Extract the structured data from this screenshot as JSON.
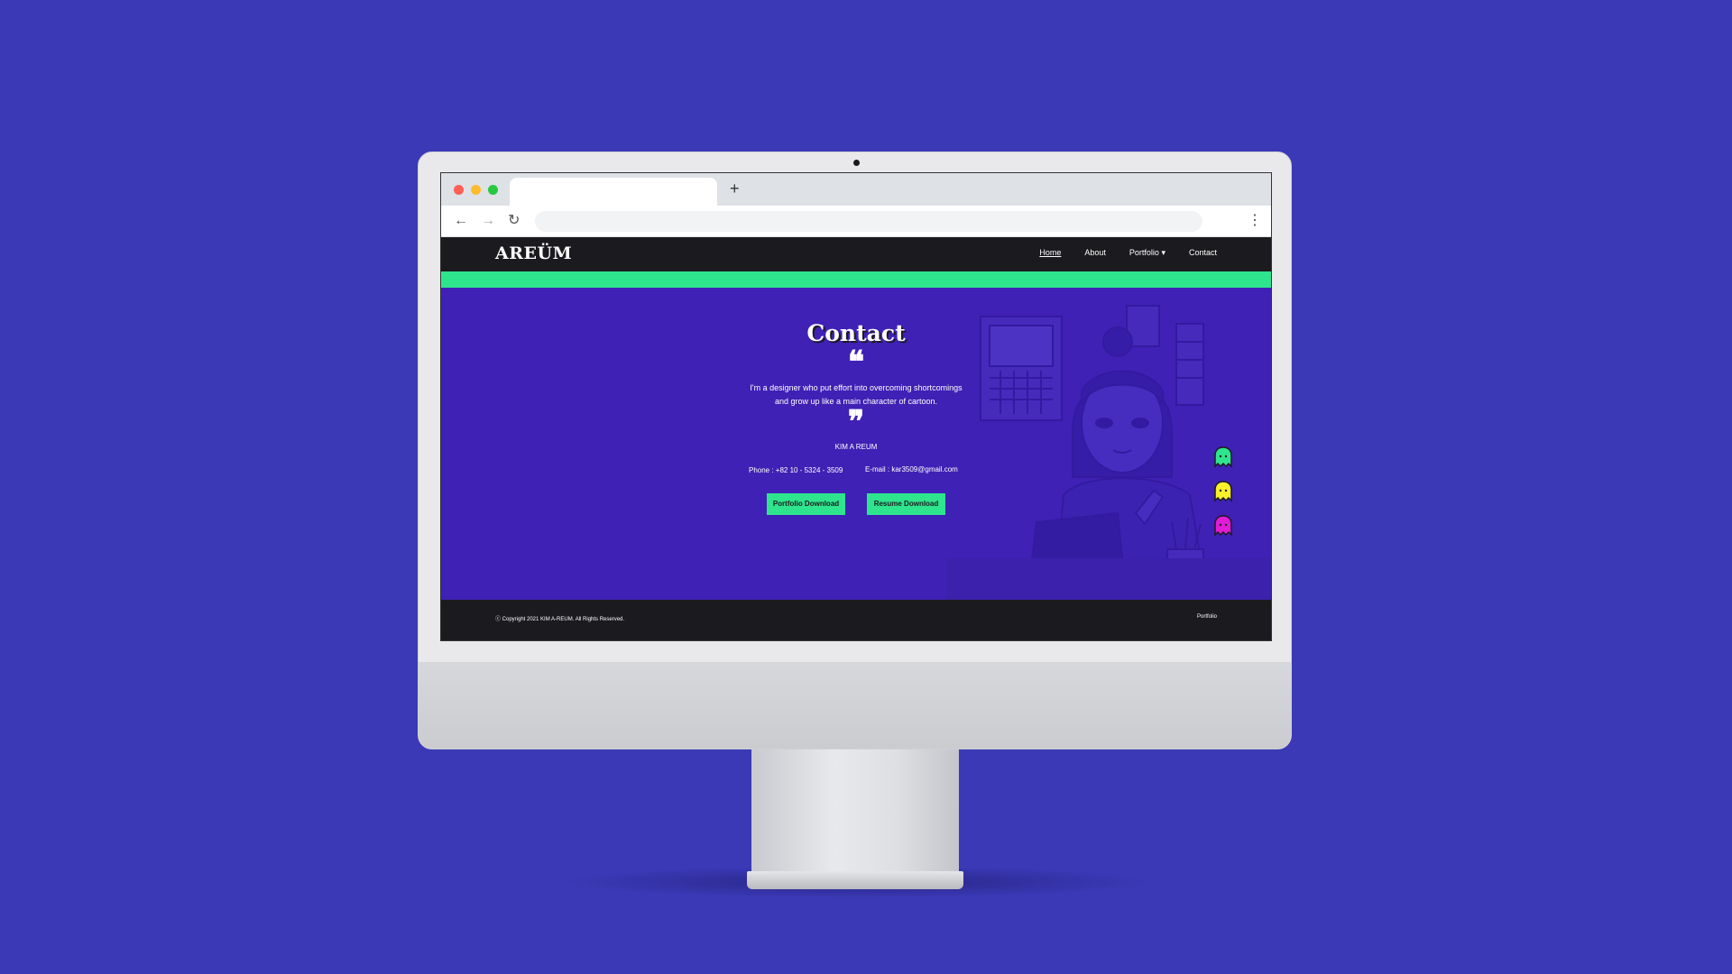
{
  "browser": {
    "new_tab_glyph": "+",
    "back_glyph": "←",
    "forward_glyph": "→",
    "reload_glyph": "↻",
    "menu_glyph": "⋮",
    "url": ""
  },
  "site": {
    "logo": "AREÜM",
    "nav": [
      {
        "label": "Home",
        "active": true
      },
      {
        "label": "About"
      },
      {
        "label": "Portfolio ▾"
      },
      {
        "label": "Contact"
      }
    ],
    "hero": {
      "title": "Contact",
      "quote_open": "❝",
      "quote_lines": [
        "I'm a designer who put effort into overcoming shortcomings",
        "and grow up like a main character of cartoon."
      ],
      "quote_close": "❞",
      "name": "KIM A REUM",
      "phone": "Phone : +82 10 - 5324 - 3509",
      "email": "E-mail : kar3509@gmail.com",
      "portfolio_button": "Portfolio Download",
      "resume_button": "Resume Download"
    },
    "footer": {
      "copyright": "ⓒ Copyright 2021 KIM A-REUM. All Rights Reserved.",
      "link": "Portfolio"
    }
  },
  "colors": {
    "page_bg": "#3b39b6",
    "hero_bg": "#3f21b5",
    "accent_green": "#2ee58e",
    "dark": "#1b1b1f",
    "ghost_green": "#2ee58e",
    "ghost_yellow": "#f7f02a",
    "ghost_magenta": "#e21bd8"
  }
}
